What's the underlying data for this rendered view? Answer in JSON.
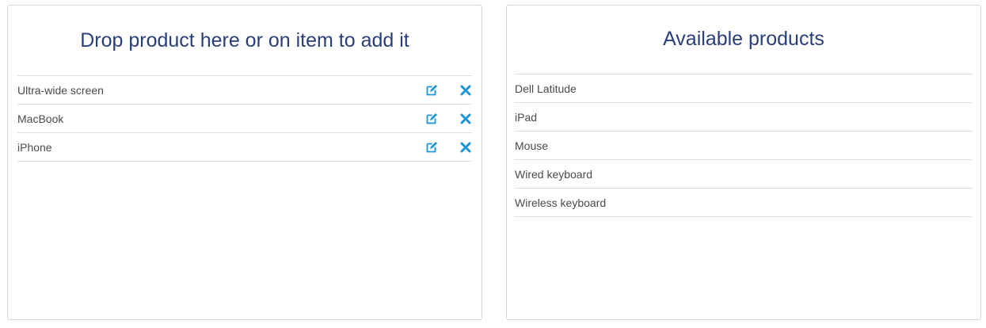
{
  "cart": {
    "title": "Drop product here or on item to add it",
    "items": [
      {
        "label": "Ultra-wide screen"
      },
      {
        "label": "MacBook"
      },
      {
        "label": "iPhone"
      }
    ],
    "actions": {
      "edit_icon": "edit-icon",
      "remove_icon": "remove-icon"
    },
    "accent_color": "#1e95d3"
  },
  "catalog": {
    "title": "Available products",
    "items": [
      {
        "label": "Dell Latitude"
      },
      {
        "label": "iPad"
      },
      {
        "label": "Mouse"
      },
      {
        "label": "Wired keyboard"
      },
      {
        "label": "Wireless keyboard"
      }
    ]
  },
  "colors": {
    "title": "#2a3f7a",
    "text": "#4a4a4a",
    "divider": "#dcdcdc",
    "border": "#d6d6d6"
  }
}
